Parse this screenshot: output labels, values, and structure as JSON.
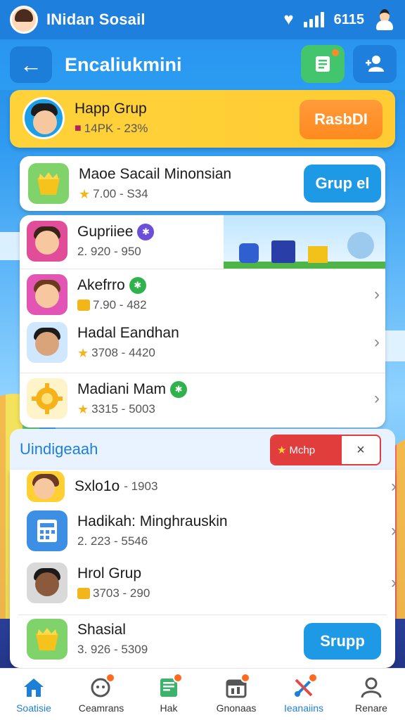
{
  "statusbar": {
    "title": "INidan Sosail",
    "time": "6115"
  },
  "header": {
    "title": "Encaliukmini"
  },
  "featured": {
    "name": "Happ Grup",
    "meta": "14PK - 23%",
    "button": "RasbDI"
  },
  "group_card": {
    "name": "Maoe Sacail Minonsian",
    "meta": "7.00 - S34",
    "button": "Grup el"
  },
  "list1": [
    {
      "name": "Gupriiee",
      "meta": "2. 920 - 950",
      "badge_color": "#6b4fd8"
    },
    {
      "name": "Akefrro",
      "meta": "7.90 - 482",
      "badge_color": "#2fb24c"
    },
    {
      "name": "Hadal Eandhan",
      "meta": "3708 - 4420",
      "badge_color": ""
    },
    {
      "name": "Madiani Mam",
      "meta": "3315 - 5003",
      "badge_color": "#2fb24c"
    }
  ],
  "section": {
    "title": "Uindigeaah",
    "pill_label": "Mchp",
    "close": "×"
  },
  "list2": [
    {
      "name": "Sxlo1o",
      "meta": "- 1903"
    },
    {
      "name": "Hadikah: Minghrauskin",
      "meta": "2. 223 - 5546"
    },
    {
      "name": "Hrol Grup",
      "meta": "3703 - 290"
    },
    {
      "name": "Shasial",
      "meta": "3. 926 - 5309",
      "button": "Srupp"
    }
  ],
  "nav": [
    {
      "label": "Soatisie",
      "icon": "home-icon"
    },
    {
      "label": "Ceamrans",
      "icon": "chat-icon"
    },
    {
      "label": "Hak",
      "icon": "tablet-icon"
    },
    {
      "label": "Gnonaas",
      "icon": "calendar-icon"
    },
    {
      "label": "Ieanaiins",
      "icon": "tools-icon"
    },
    {
      "label": "Renare",
      "icon": "profile-icon"
    }
  ],
  "colors": {
    "primary": "#1f7fdc",
    "accent_orange": "#ff8a1f",
    "featured_bg": "#ffd23a",
    "green": "#43c56e",
    "red": "#e23d3d"
  }
}
